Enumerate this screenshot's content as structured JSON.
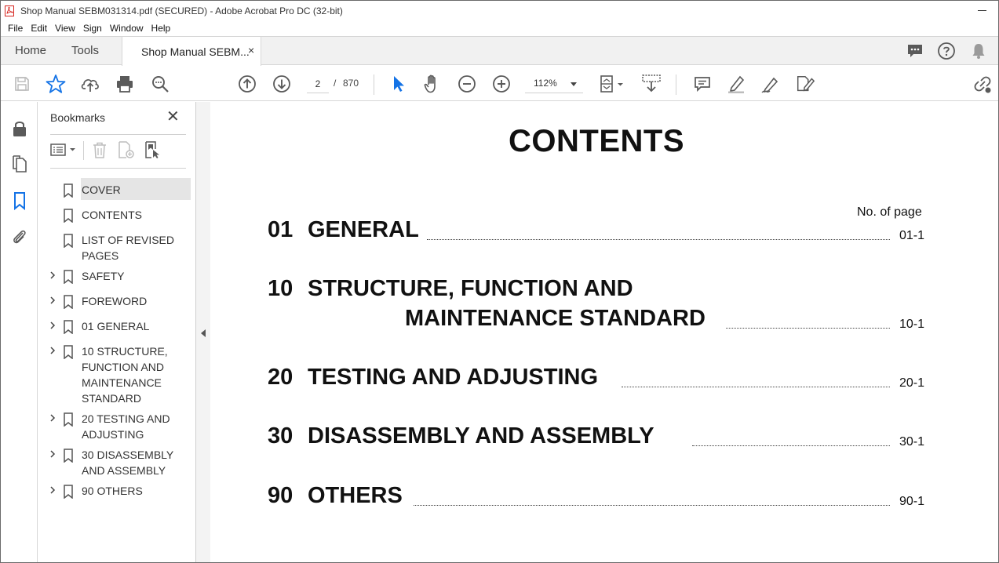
{
  "window": {
    "title": "Shop Manual SEBM031314.pdf (SECURED) - Adobe Acrobat Pro DC (32-bit)"
  },
  "menu": [
    "File",
    "Edit",
    "View",
    "Sign",
    "Window",
    "Help"
  ],
  "tabs": {
    "home": "Home",
    "tools": "Tools",
    "document": "Shop Manual SEBM...",
    "close": "×"
  },
  "toolbar": {
    "current_page": "2",
    "separator": "/",
    "total_pages": "870",
    "zoom": "112%"
  },
  "bookmarks": {
    "title": "Bookmarks",
    "close": "✕",
    "items": [
      {
        "label": "COVER",
        "expandable": false,
        "selected": true
      },
      {
        "label": "CONTENTS",
        "expandable": false,
        "selected": false
      },
      {
        "label": "LIST OF REVISED PAGES",
        "expandable": false,
        "selected": false
      },
      {
        "label": "SAFETY",
        "expandable": true,
        "selected": false
      },
      {
        "label": "FOREWORD",
        "expandable": true,
        "selected": false
      },
      {
        "label": "01 GENERAL",
        "expandable": true,
        "selected": false
      },
      {
        "label": "10 STRUCTURE, FUNCTION AND MAINTENANCE STANDARD",
        "expandable": true,
        "selected": false
      },
      {
        "label": "20 TESTING AND ADJUSTING",
        "expandable": true,
        "selected": false
      },
      {
        "label": "30 DISASSEMBLY AND ASSEMBLY",
        "expandable": true,
        "selected": false
      },
      {
        "label": "90 OTHERS",
        "expandable": true,
        "selected": false
      }
    ]
  },
  "document": {
    "heading": "CONTENTS",
    "page_col_label": "No. of page",
    "entries": [
      {
        "num": "01",
        "line1": "GENERAL",
        "line2": "",
        "page": "01-1"
      },
      {
        "num": "10",
        "line1": "STRUCTURE, FUNCTION AND",
        "line2": "MAINTENANCE STANDARD",
        "page": "10-1"
      },
      {
        "num": "20",
        "line1": "TESTING AND ADJUSTING",
        "line2": "",
        "page": "20-1"
      },
      {
        "num": "30",
        "line1": "DISASSEMBLY AND ASSEMBLY",
        "line2": "",
        "page": "30-1"
      },
      {
        "num": "90",
        "line1": "OTHERS",
        "line2": "",
        "page": "90-1"
      }
    ]
  },
  "colors": {
    "accent_blue": "#1473e6",
    "icon_gray": "#5a5a5a"
  }
}
